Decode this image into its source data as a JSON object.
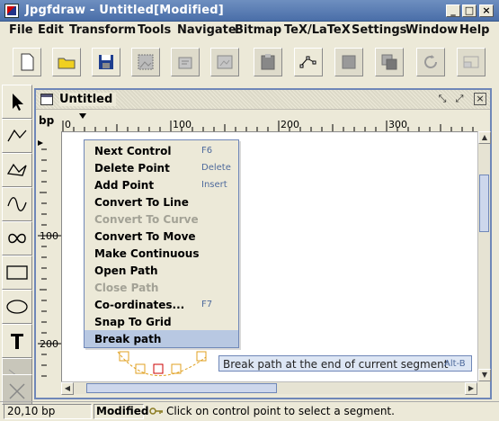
{
  "window": {
    "title": "Jpgfdraw - Untitled[Modified]"
  },
  "menubar": [
    "File",
    "Edit",
    "Transform",
    "Tools",
    "Navigate",
    "Bitmap",
    "TeX/LaTeX",
    "Settings",
    "Window",
    "Help"
  ],
  "toolbar": [
    {
      "icon": "new-document-icon",
      "enabled": true
    },
    {
      "icon": "open-folder-icon",
      "enabled": true
    },
    {
      "icon": "save-disk-icon",
      "enabled": true
    },
    {
      "icon": "select-image-icon",
      "enabled": false
    },
    {
      "icon": "construct-icon",
      "enabled": false
    },
    {
      "icon": "frame-icon",
      "enabled": false
    },
    {
      "icon": "paste-icon",
      "enabled": false
    },
    {
      "icon": "edit-path-icon",
      "enabled": true
    },
    {
      "icon": "front-icon",
      "enabled": false
    },
    {
      "icon": "back-icon",
      "enabled": false
    },
    {
      "icon": "rotate-icon",
      "enabled": false
    },
    {
      "icon": "scale-icon",
      "enabled": false
    }
  ],
  "palette": [
    "select-arrow-icon",
    "open-line-icon",
    "closed-line-icon",
    "curve-icon",
    "infinity-loop-icon",
    "rectangle-icon",
    "ellipse-icon",
    "text-tool-icon",
    "math-tool-icon",
    "close-tool-icon"
  ],
  "frame": {
    "title": "Untitled",
    "unit": "bp"
  },
  "ruler": {
    "h_labels": [
      "0",
      "100",
      "200",
      "300"
    ],
    "v_labels": [
      "100",
      "200"
    ]
  },
  "context_menu": [
    {
      "label": "Next Control",
      "shortcut": "F6",
      "enabled": true
    },
    {
      "label": "Delete Point",
      "shortcut": "Delete",
      "enabled": true
    },
    {
      "label": "Add Point",
      "shortcut": "Insert",
      "enabled": true
    },
    {
      "label": "Convert To Line",
      "shortcut": "",
      "enabled": true
    },
    {
      "label": "Convert To Curve",
      "shortcut": "",
      "enabled": false
    },
    {
      "label": "Convert To Move",
      "shortcut": "",
      "enabled": true
    },
    {
      "label": "Make Continuous",
      "shortcut": "",
      "enabled": true
    },
    {
      "label": "Open Path",
      "shortcut": "",
      "enabled": true
    },
    {
      "label": "Close Path",
      "shortcut": "",
      "enabled": false
    },
    {
      "label": "Co-ordinates...",
      "shortcut": "F7",
      "enabled": true
    },
    {
      "label": "Snap To Grid",
      "shortcut": "",
      "enabled": true
    },
    {
      "label": "Break path",
      "shortcut": "",
      "enabled": true,
      "selected": true
    }
  ],
  "tooltip": {
    "text": "Break path at the end of current segment",
    "shortcut": "Alt-B"
  },
  "status": {
    "coords": "20,10 bp",
    "modified": "Modified",
    "message": "Click on control point to select a segment."
  },
  "colors": {
    "accent": "#6f87b8",
    "control_point": "#e0a020",
    "selected_point": "#cc0000"
  }
}
